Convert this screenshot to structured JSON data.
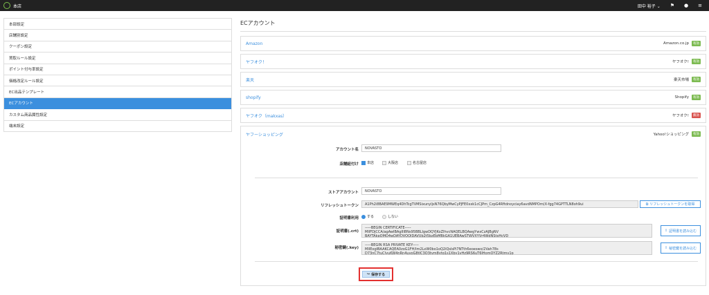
{
  "app": {
    "name": "本店"
  },
  "header": {
    "user": "田中 裕子",
    "chevron": "⌄"
  },
  "sidebar": {
    "items": [
      {
        "label": "本部設定",
        "active": false
      },
      {
        "label": "店舗別設定",
        "active": false
      },
      {
        "label": "クーポン設定",
        "active": false
      },
      {
        "label": "買取ルール設定",
        "active": false
      },
      {
        "label": "ポイント付与率設定",
        "active": false
      },
      {
        "label": "価格改定ルール設定",
        "active": false
      },
      {
        "label": "EC出品テンプレート",
        "active": false
      },
      {
        "label": "ECアカウント",
        "active": true
      },
      {
        "label": "カスタム商品属性設定",
        "active": false
      },
      {
        "label": "端末設定",
        "active": false
      }
    ]
  },
  "main": {
    "title": "ECアカウント",
    "accounts": [
      {
        "name": "Amazon",
        "site": "Amazon.co.jp",
        "status": "有効",
        "ok": true
      },
      {
        "name": "ヤフオク！",
        "site": "ヤフオク!",
        "status": "有効",
        "ok": true
      },
      {
        "name": "楽天",
        "site": "楽天市場",
        "status": "有効",
        "ok": true
      },
      {
        "name": "shopify",
        "site": "Shopify",
        "status": "有効",
        "ok": true
      },
      {
        "name": "ヤフオク（makxas）",
        "site": "ヤフオク!",
        "status": "無効",
        "ok": false
      }
    ],
    "panel": {
      "name": "ヤフーショッピング",
      "site": "Yahoo!ショッピング",
      "status": "有効",
      "form": {
        "account_label": "アカウント名",
        "account_value": "NOVASTO",
        "store_link_label": "店舗紐付け",
        "stores": [
          {
            "label": "本店",
            "checked": true
          },
          {
            "label": "大阪店",
            "checked": false
          },
          {
            "label": "名古屋店",
            "checked": false
          }
        ],
        "store_account_label": "ストアアカウント",
        "store_account_value": "NOVASTO",
        "refresh_label": "リフレッシュトークン",
        "refresh_value": "A1Ph2i8BAE9MWEq4DhTcgTVMSixunyljsN76QbyMwCyPJFE0xxk1cCJPm_CzpG4Rftdnoyciay6avdNMPOm(X-fgg74GPTTLN8oh9ui",
        "refresh_button": "リフレッシュトークンを取得",
        "cert_use_label": "証明書利用",
        "cert_use_options": [
          {
            "label": "する",
            "checked": true
          },
          {
            "label": "しない",
            "checked": false
          }
        ],
        "cert_label": "証明書(.crt)",
        "cert_value": "-----BEGIN CERTIFICATE-----\nMIIFDjCCA/agAwIBAgIII8Ns95BBLIgwDQYJKoZIhvcNAQELBQAwgYwxCzAJBgNV\nBAYTAkpQMQ4wDAYDVQQIDAVUb2t5bzEbMBkGA1UEBAwSTWVXYVr4WdNStxHcVD",
        "cert_button": "証明書を読み込む",
        "key_label": "秘密鍵(.key)",
        "key_value": "-----BEGIN RSA PRIVATE KEY-----\nMIIEogIBAAKCAQEA0zoG1FH/Im2LxW0bo1oQ2iQslsPi7NTth6eoeswo/2Vah78s\nD73nC7tuClyuKW4nRn4uvoG8tIC3Q3tvm8ytq1s1Xby1vHz9RS6uT6lHomQYZ2Rtmv1p",
        "key_button": "秘密鍵を読み込む",
        "save_button": "保存する"
      }
    }
  }
}
